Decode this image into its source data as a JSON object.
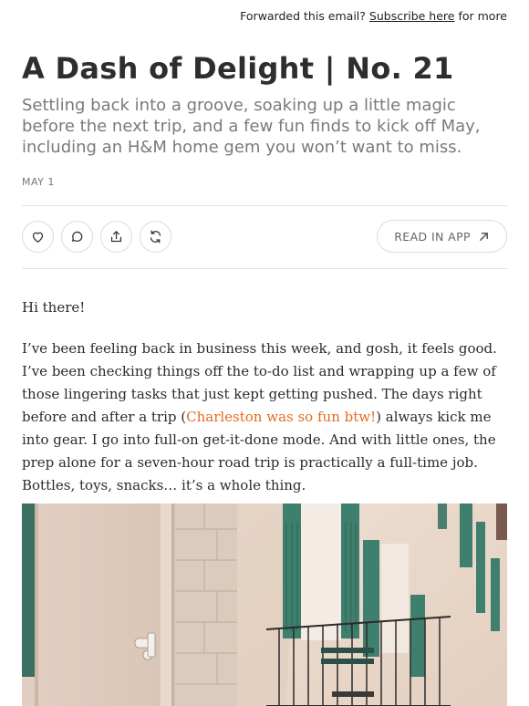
{
  "topbar": {
    "forwarded_text": "Forwarded this email?",
    "subscribe_link": "Subscribe here",
    "suffix": "for more"
  },
  "post": {
    "title": "A Dash of Delight | No. 21",
    "subtitle": "Settling back into a groove, soaking up a little magic before the next trip, and a few fun finds to kick off May, including an H&M home gem you won’t want to miss.",
    "date": "MAY 1"
  },
  "actions": {
    "icons": [
      "heart-icon",
      "comment-icon",
      "share-icon",
      "restack-icon"
    ],
    "read_in_app": "READ IN APP"
  },
  "content": {
    "greeting": "Hi there!",
    "para_before_link": "I’ve been feeling back in business this week, and gosh, it feels good. I’ve been checking things off the to-do list and wrapping up a few of those lingering tasks that just kept getting pushed. The days right before and after a trip (",
    "link_text": "Charleston was so fun btw!",
    "para_after_link": ") always kick me into gear. I go into full-on get-it-done mode. And with little ones, the prep alone for a seven-hour road trip is practically a full-time job. Bottles, toys, snacks… it’s a whole thing."
  },
  "colors": {
    "link": "#e66a1f",
    "shutter_green": "#3f7f6e",
    "wall": "#e6d2c3"
  }
}
